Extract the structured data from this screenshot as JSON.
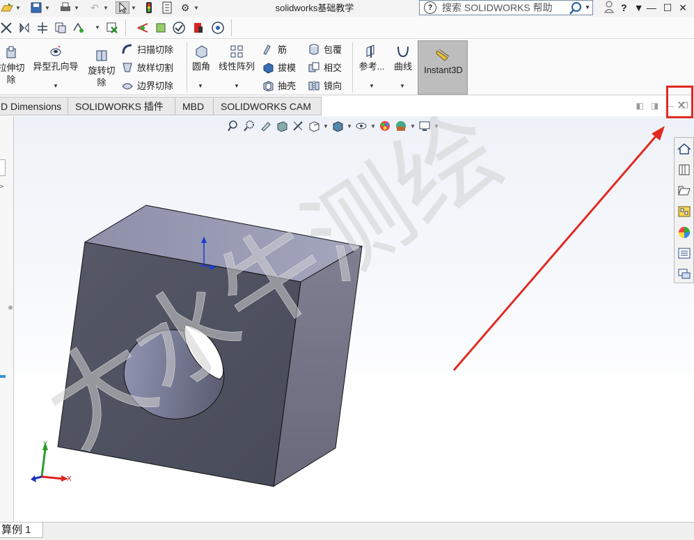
{
  "titlebar": {
    "app_title": "solidworks基础教学",
    "search_placeholder": "搜索 SOLIDWORKS 帮助",
    "help_glyph": "?",
    "window_controls": [
      "—",
      "☐",
      "✕"
    ]
  },
  "ribbon": {
    "extrude_cut": "拉伸切\n除",
    "hole_wizard": "异型孔向导",
    "revolve_cut": "旋转切\n除",
    "swept_cut": "扫描切除",
    "lofted_cut": "放样切割",
    "boundary_cut": "边界切除",
    "fillet": "圆角",
    "linear_pattern": "线性阵列",
    "rib": "筋",
    "draft": "拔模",
    "shell": "抽壳",
    "wrap": "包覆",
    "intersect": "相交",
    "mirror": "镜向",
    "reference": "参考...",
    "curves": "曲线",
    "instant3d": "Instant3D"
  },
  "tabs": [
    {
      "label": "D Dimensions"
    },
    {
      "label": "SOLIDWORKS 插件"
    },
    {
      "label": "MBD"
    },
    {
      "label": "SOLIDWORKS CAM"
    }
  ],
  "bottom": {
    "config_tab": "算例 1"
  },
  "watermark": "大水牛测绘",
  "colors": {
    "highlight": "#e02a22",
    "arrow": "#e02a22",
    "part_front": "#4f5260",
    "part_top": "#9a9cb4",
    "part_side": "#6e7080"
  },
  "icons": {
    "doc_close": "close-icon"
  }
}
